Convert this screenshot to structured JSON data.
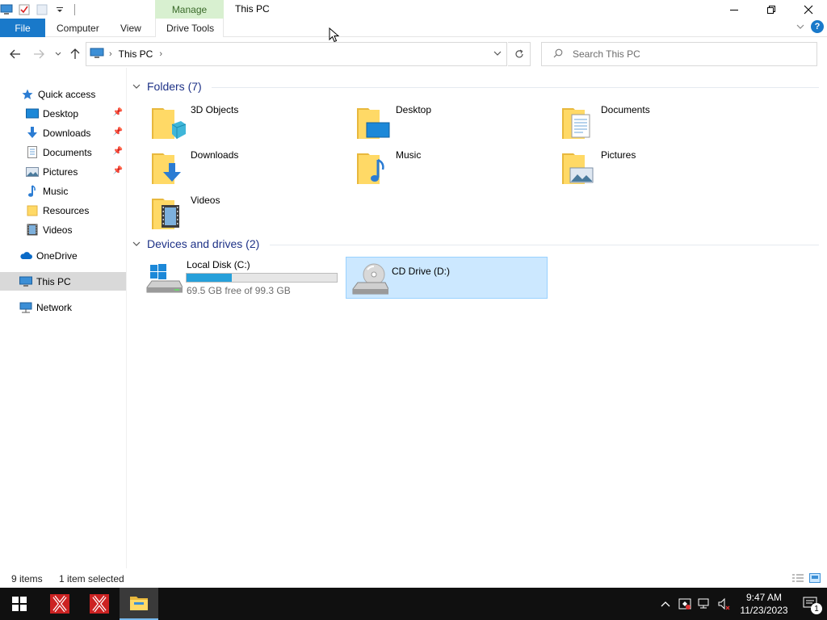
{
  "window": {
    "contextual_tab": "Manage",
    "title": "This PC"
  },
  "ribbon": {
    "file": "File",
    "tabs": [
      "Computer",
      "View",
      "Drive Tools"
    ]
  },
  "address": {
    "crumb": "This PC"
  },
  "search": {
    "placeholder": "Search This PC"
  },
  "navpane": {
    "quick_access": "Quick access",
    "quick_items": [
      {
        "label": "Desktop",
        "icon": "desktop-icon",
        "pinned": true
      },
      {
        "label": "Downloads",
        "icon": "downloads-icon",
        "pinned": true
      },
      {
        "label": "Documents",
        "icon": "documents-icon",
        "pinned": true
      },
      {
        "label": "Pictures",
        "icon": "pictures-icon",
        "pinned": true
      },
      {
        "label": "Music",
        "icon": "music-icon",
        "pinned": false
      },
      {
        "label": "Resources",
        "icon": "folder-icon",
        "pinned": false
      },
      {
        "label": "Videos",
        "icon": "videos-icon",
        "pinned": false
      }
    ],
    "onedrive": "OneDrive",
    "this_pc": "This PC",
    "network": "Network"
  },
  "content": {
    "folders_header": "Folders (7)",
    "folders": [
      {
        "name": "3D Objects",
        "icon": "3d-objects-icon"
      },
      {
        "name": "Desktop",
        "icon": "desktop-folder-icon"
      },
      {
        "name": "Documents",
        "icon": "documents-folder-icon"
      },
      {
        "name": "Downloads",
        "icon": "downloads-folder-icon"
      },
      {
        "name": "Music",
        "icon": "music-folder-icon"
      },
      {
        "name": "Pictures",
        "icon": "pictures-folder-icon"
      },
      {
        "name": "Videos",
        "icon": "videos-folder-icon"
      }
    ],
    "devices_header": "Devices and drives (2)",
    "drives": [
      {
        "name": "Local Disk (C:)",
        "info": "69.5 GB free of 99.3 GB",
        "used_fraction": 0.3,
        "selected": false
      },
      {
        "name": "CD Drive (D:)",
        "info": "",
        "selected": true
      }
    ]
  },
  "status": {
    "count": "9 items",
    "selection": "1 item selected"
  },
  "taskbar": {
    "time": "9:47 AM",
    "date": "11/23/2023",
    "notifications": "1"
  },
  "colors": {
    "accent": "#1979ca",
    "selection": "#cce8ff",
    "drive_fill": "#26a0da",
    "group_header": "#1e3287",
    "manage_tab": "#d8f0d0"
  }
}
